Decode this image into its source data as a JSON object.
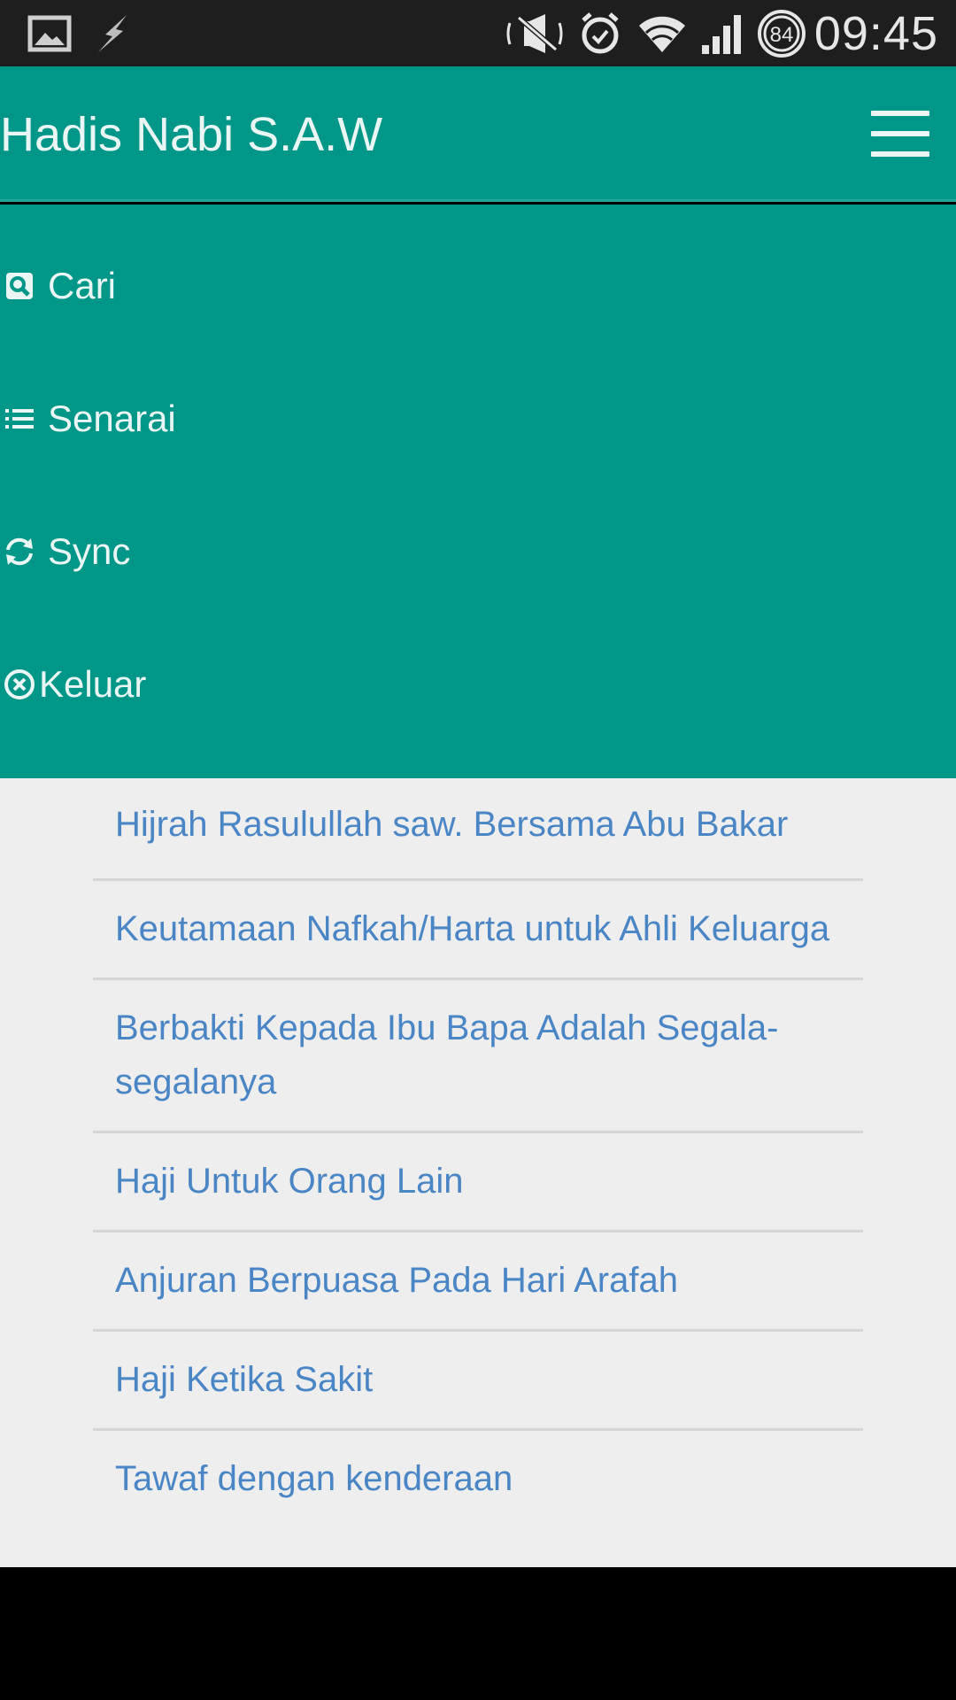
{
  "status_bar": {
    "time": "09:45",
    "battery": "84",
    "icons": [
      "gallery-icon",
      "flash-icon",
      "mute-icon",
      "alarm-icon",
      "wifi-icon",
      "signal-icon",
      "battery-icon"
    ]
  },
  "header": {
    "title": "Hadis Nabi S.A.W",
    "menu_icon": "hamburger-icon"
  },
  "menu": {
    "items": [
      {
        "label": "Cari",
        "icon": "search-icon"
      },
      {
        "label": "Senarai",
        "icon": "list-icon"
      },
      {
        "label": "Sync",
        "icon": "sync-icon"
      },
      {
        "label": "Keluar",
        "icon": "close-circle-icon"
      }
    ]
  },
  "list": {
    "items": [
      "Hijrah Rasulullah saw. Bersama Abu Bakar",
      "Keutamaan Nafkah/Harta untuk Ahli Keluarga",
      "Berbakti Kepada Ibu Bapa Adalah Segala-segalanya",
      "Haji Untuk Orang Lain",
      "Anjuran Berpuasa Pada Hari Arafah",
      "Haji Ketika Sakit",
      "Tawaf dengan kenderaan"
    ]
  },
  "colors": {
    "accent": "#009688",
    "link": "#4a86c5",
    "content_bg": "#eeeeee",
    "status_bar": "#1e1e1e"
  }
}
